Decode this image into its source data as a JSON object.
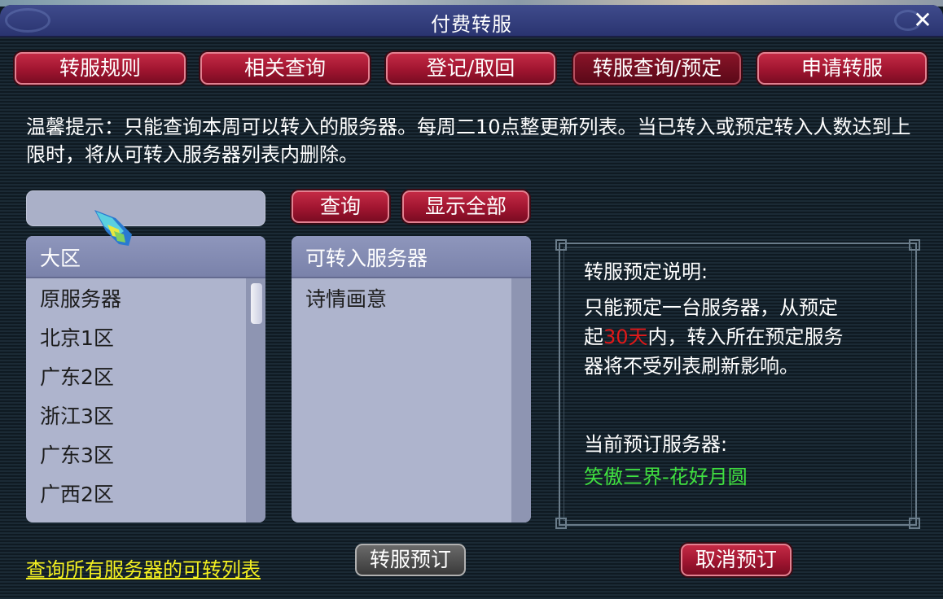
{
  "window": {
    "title": "付费转服",
    "close_label": "✕"
  },
  "tabs": [
    {
      "label": "转服规则",
      "active": false
    },
    {
      "label": "相关查询",
      "active": false
    },
    {
      "label": "登记/取回",
      "active": false
    },
    {
      "label": "转服查询/预定",
      "active": true
    },
    {
      "label": "申请转服",
      "active": false
    }
  ],
  "notice": "温馨提示：只能查询本周可以转入的服务器。每周二10点整更新列表。当已转入或预定转入人数达到上限时，将从可转入服务器列表内删除。",
  "search": {
    "value": "",
    "placeholder": "",
    "query_label": "查询",
    "show_all_label": "显示全部"
  },
  "region_list": {
    "header": "大区",
    "items": [
      "原服务器",
      "北京1区",
      "广东2区",
      "浙江3区",
      "广东3区",
      "广西2区"
    ]
  },
  "server_list": {
    "header": "可转入服务器",
    "items": [
      "诗情画意"
    ]
  },
  "info": {
    "title": "转服预定说明:",
    "line1": "只能预定一台服务器，从预定",
    "line2_pre": "起",
    "line2_highlight": "30天",
    "line2_post": "内，转入所在预定服务",
    "line3": "器将不受列表刷新影响。",
    "current_label": "当前预订服务器:",
    "current_value": "笑傲三界-花好月圆"
  },
  "footer": {
    "link_label": "查询所有服务器的可转列表",
    "reserve_label": "转服预订",
    "cancel_label": "取消预订"
  },
  "colors": {
    "highlight_red": "#e01818",
    "current_server_green": "#40e040",
    "link_yellow": "#f4f020",
    "button_red": "#a01530"
  }
}
